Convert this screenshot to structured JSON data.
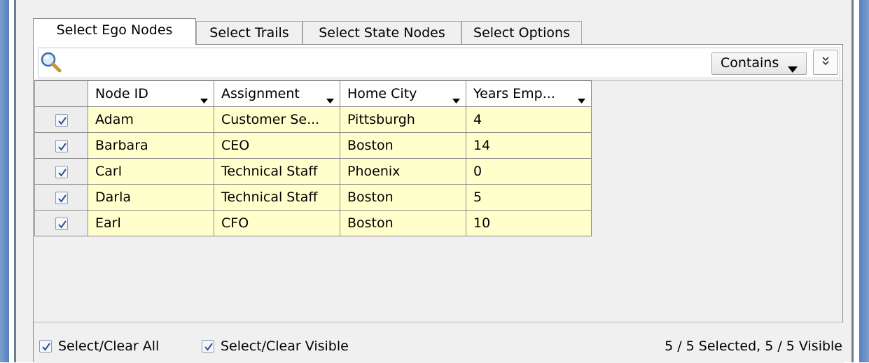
{
  "tabs": [
    {
      "label": "Select Ego Nodes",
      "active": true
    },
    {
      "label": "Select Trails",
      "active": false
    },
    {
      "label": "Select State Nodes",
      "active": false
    },
    {
      "label": "Select Options",
      "active": false
    }
  ],
  "search": {
    "value": "",
    "placeholder": "",
    "mode_label": "Contains",
    "expand_symbol": "»"
  },
  "table": {
    "columns": [
      "Node ID",
      "Assignment",
      "Home City",
      "Years Emp..."
    ],
    "rows": [
      {
        "checked": true,
        "cells": [
          "Adam",
          "Customer Se...",
          "Pittsburgh",
          "4"
        ]
      },
      {
        "checked": true,
        "cells": [
          "Barbara",
          "CEO",
          "Boston",
          "14"
        ]
      },
      {
        "checked": true,
        "cells": [
          "Carl",
          "Technical Staff",
          "Phoenix",
          "0"
        ]
      },
      {
        "checked": true,
        "cells": [
          "Darla",
          "Technical Staff",
          "Boston",
          "5"
        ]
      },
      {
        "checked": true,
        "cells": [
          "Earl",
          "CFO",
          "Boston",
          "10"
        ]
      }
    ]
  },
  "footer": {
    "select_all_label": "Select/Clear All",
    "select_visible_label": "Select/Clear Visible",
    "status": "5 / 5 Selected, 5 / 5 Visible"
  },
  "colors": {
    "row_bg": "#ffffcc",
    "window_frame": "#5580bf",
    "panel_bg": "#f0f0f0"
  }
}
